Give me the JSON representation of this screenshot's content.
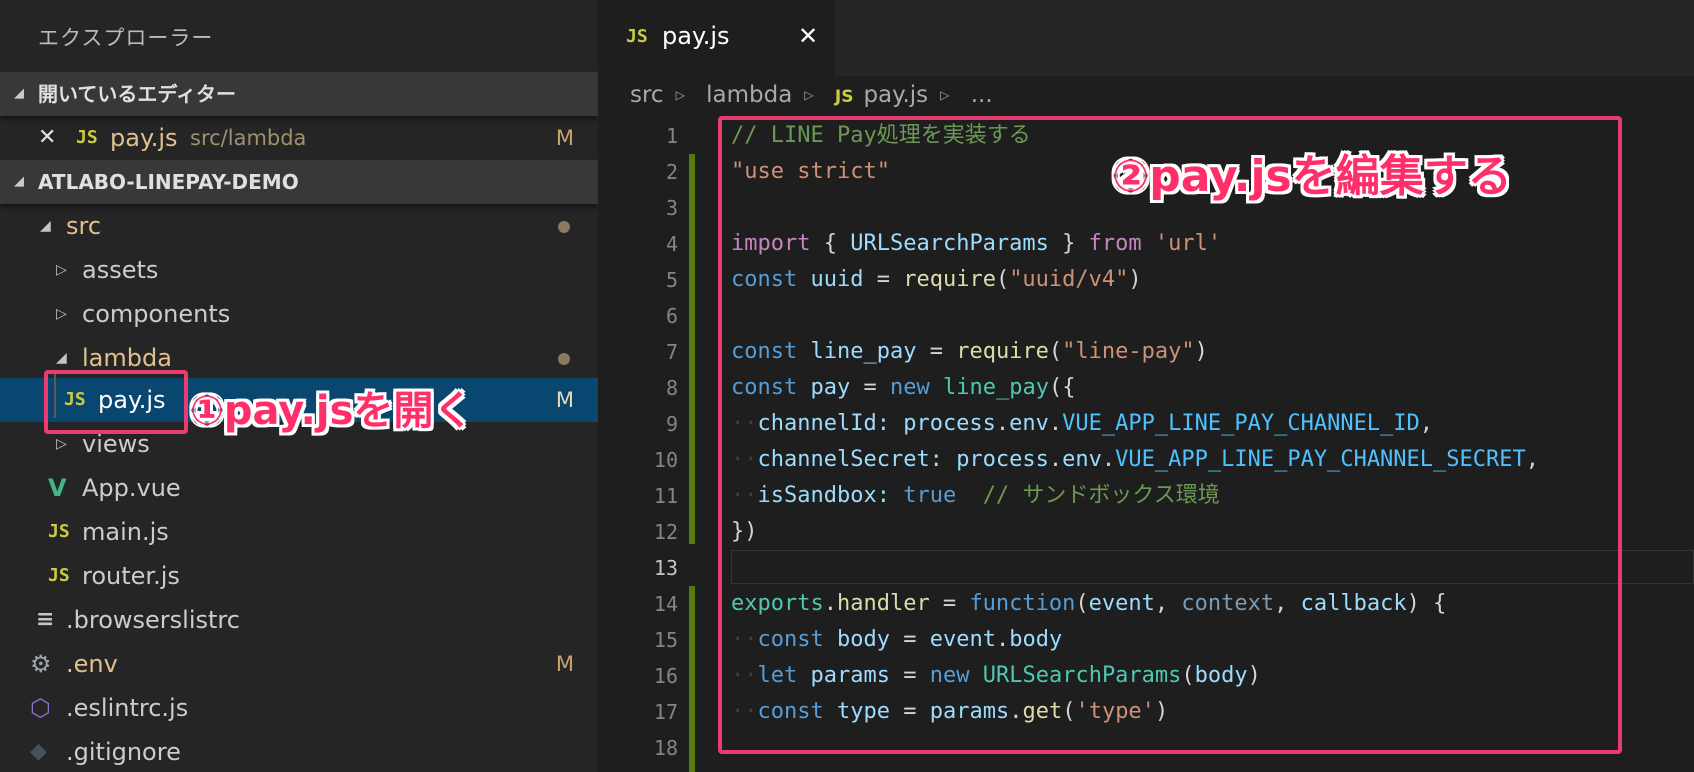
{
  "sidebar": {
    "title": "エクスプローラー",
    "open_editors": {
      "header": "開いているエディター",
      "item": {
        "name": "pay.js",
        "path": "src/lambda",
        "status": "M"
      }
    },
    "project": {
      "header": "ATLABO-LINEPAY-DEMO",
      "tree": {
        "src": "src",
        "assets": "assets",
        "components": "components",
        "lambda": "lambda",
        "pay": "pay.js",
        "pay_status": "M",
        "views": "views",
        "app_vue": "App.vue",
        "main_js": "main.js",
        "router_js": "router.js",
        "browserslistrc": ".browserslistrc",
        "env": ".env",
        "env_status": "M",
        "eslintrc": ".eslintrc.js",
        "gitignore": ".gitignore"
      }
    }
  },
  "editor": {
    "tab": {
      "icon": "JS",
      "label": "pay.js"
    },
    "breadcrumbs": [
      "src",
      "lambda",
      "pay.js",
      "..."
    ],
    "line_numbers": [
      "1",
      "2",
      "3",
      "4",
      "5",
      "6",
      "7",
      "8",
      "9",
      "10",
      "11",
      "12",
      "13",
      "14",
      "15",
      "16",
      "17",
      "18"
    ],
    "code": {
      "l1": "// LINE Pay処理を実装する",
      "l2": "\"use strict\"",
      "l4_import": "import",
      "l4_a": " { ",
      "l4_b": "URLSearchParams",
      "l4_c": " } ",
      "l4_from": "from",
      "l4_str": "'url'",
      "const": "const",
      "l5_var": "uuid",
      "eq": " = ",
      "require": "require",
      "l5_str": "\"uuid/v4\"",
      "l7_var": "line_pay",
      "l7_str": "\"line-pay\"",
      "l8_var": "pay",
      "new": "new",
      "l8_fn": "line_pay",
      "l8_tail": "({",
      "l9_key": "channelId:",
      "process": "process",
      "dot": ".",
      "env": "env",
      "l9_cst": "VUE_APP_LINE_PAY_CHANNEL_ID",
      "comma": ",",
      "l10_key": "channelSecret:",
      "l10_cst": "VUE_APP_LINE_PAY_CHANNEL_SECRET",
      "l11_key": "isSandbox:",
      "l11_true": "true",
      "l11_cmt": "// サンドボックス環境",
      "l12": "})",
      "l14_exports": "exports",
      "l14_handler": "handler",
      "l14_function": "function",
      "l14_event": "event",
      "l14_context": "context",
      "l14_callback": "callback",
      "l15_var": "body",
      "l15_event": "event",
      "l15_body": "body",
      "let": "let",
      "l16_var": "params",
      "l16_cls": "URLSearchParams",
      "l16_arg": "body",
      "l17_var": "type",
      "l17_params": "params",
      "l17_get": "get",
      "l17_str": "'type'"
    }
  },
  "annotations": {
    "open": "①pay.jsを開く",
    "edit": "②pay.jsを編集する"
  },
  "colors": {
    "annotation": "#e83b6f",
    "selection": "#094771",
    "git_added": "#587c0c"
  }
}
